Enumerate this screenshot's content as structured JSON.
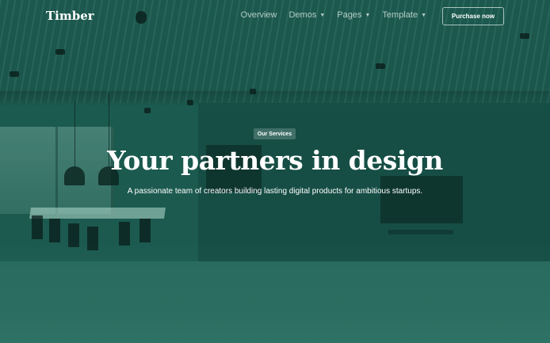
{
  "brand": {
    "logo_text": "Timber"
  },
  "nav": {
    "items": [
      {
        "label": "Overview",
        "has_dropdown": false
      },
      {
        "label": "Demos",
        "has_dropdown": true
      },
      {
        "label": "Pages",
        "has_dropdown": true
      },
      {
        "label": "Template",
        "has_dropdown": true
      }
    ],
    "dropdown_icon": "chevron-down-icon",
    "cta_label": "Purchase now"
  },
  "hero": {
    "badge": "Our Services",
    "headline": "Your partners in design",
    "subheadline": "A passionate team of creators building lasting digital products for ambitious startups."
  },
  "colors": {
    "overlay": "#1b5a4f",
    "text": "#ffffff"
  }
}
